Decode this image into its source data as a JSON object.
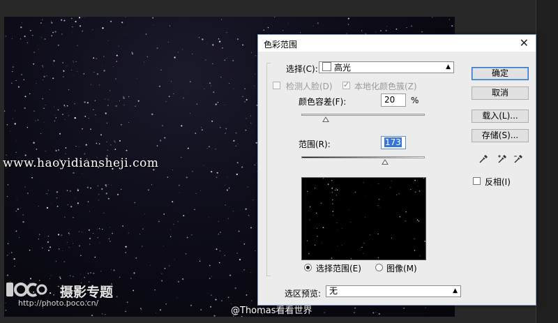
{
  "watermarks": {
    "site_url": "www.haoyidiansheji.com",
    "poco_title": "摄影专题",
    "poco_url": "http://photo.poco.cn/",
    "credit": "@Thomas看看世界"
  },
  "dialog": {
    "title": "色彩范围",
    "select_label": "选择(C):",
    "select_value": "高光",
    "detect_faces_label": "检测人脸(D)",
    "localized_clusters_label": "本地化颜色簇(Z)",
    "fuzziness_label": "颜色容差(F):",
    "fuzziness_value": "20",
    "fuzziness_unit": "%",
    "range_label": "范围(R):",
    "range_value": "173",
    "range_slider_fraction": 0.68,
    "fuzziness_slider_fraction": 0.2,
    "radio_selection_label": "选择范围(E)",
    "radio_image_label": "图像(M)",
    "preview_label": "选区预览:",
    "preview_value": "无",
    "ok_label": "确定",
    "cancel_label": "取消",
    "load_label": "载入(L)...",
    "save_label": "存储(S)...",
    "invert_label": "反相(I)",
    "icons": {
      "close": "close-icon",
      "eyedropper": "eyedropper-icon",
      "eyedropper_add": "eyedropper-plus-icon",
      "eyedropper_subtract": "eyedropper-minus-icon"
    },
    "colors": {
      "accent": "#3875d7",
      "frame": "#7c9cc4"
    }
  }
}
